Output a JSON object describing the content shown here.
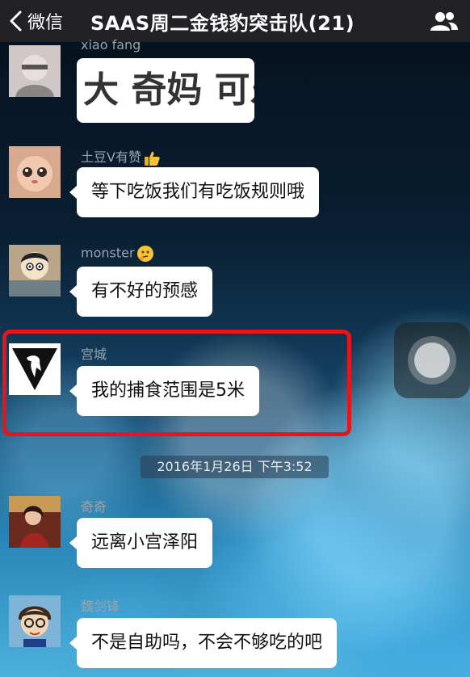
{
  "nav": {
    "back_label": "微信",
    "title": "SAAS周二金钱豹突击队(21)"
  },
  "messages": [
    {
      "sender": "xiao fang",
      "text": "大 奇妈 可乐"
    },
    {
      "sender": "土豆V有赞",
      "text": "等下吃饭我们有吃饭规则哦"
    },
    {
      "sender": "monster",
      "text": "有不好的预感"
    },
    {
      "sender": "宫城",
      "text": "我的捕食范围是5米"
    },
    {
      "sender": "奇奇",
      "text": "远离小宫泽阳"
    },
    {
      "sender": "魏剑锋",
      "text": "不是自助吗，不会不够吃的吧"
    }
  ],
  "timestamp": "2016年1月26日 下午3:52",
  "colors": {
    "highlight": "#e8141c",
    "bubble": "#ffffff",
    "nav": "#232326"
  }
}
